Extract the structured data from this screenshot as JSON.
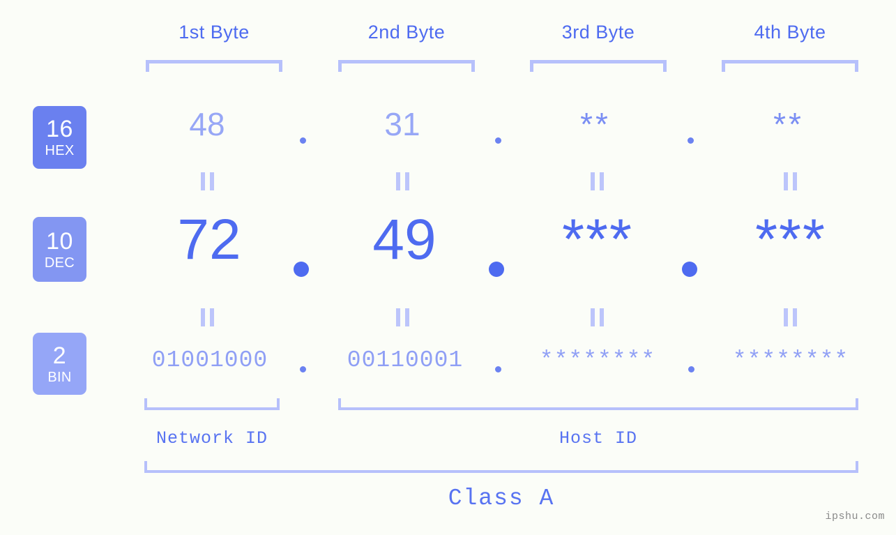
{
  "page": {
    "background_color": "#fbfdf8",
    "accent_color": "#4e6bf0",
    "accent_light": "#b6c0fb",
    "watermark": "ipshu.com"
  },
  "byte_headers": [
    {
      "label": "1st Byte"
    },
    {
      "label": "2nd Byte"
    },
    {
      "label": "3rd Byte"
    },
    {
      "label": "4th Byte"
    }
  ],
  "bases": [
    {
      "number": "16",
      "name": "HEX",
      "color": "#6a80ef"
    },
    {
      "number": "10",
      "name": "DEC",
      "color": "#8396f2"
    },
    {
      "number": "2",
      "name": "BIN",
      "color": "#95a6f7"
    }
  ],
  "rows": {
    "hex": {
      "base_number": "16",
      "base_name": "HEX",
      "values": [
        "48",
        "31",
        "**",
        "**"
      ],
      "separator": "."
    },
    "dec": {
      "base_number": "10",
      "base_name": "DEC",
      "values": [
        "72",
        "49",
        "***",
        "***"
      ],
      "separator": "."
    },
    "bin": {
      "base_number": "2",
      "base_name": "BIN",
      "values": [
        "01001000",
        "00110001",
        "********",
        "********"
      ],
      "separator": "."
    }
  },
  "equivalence_marks": {
    "glyph": "equals-vertical",
    "count_per_gap": 4,
    "gaps": 2
  },
  "footer": {
    "network_id_label": "Network ID",
    "host_id_label": "Host ID",
    "class_label": "Class A"
  }
}
